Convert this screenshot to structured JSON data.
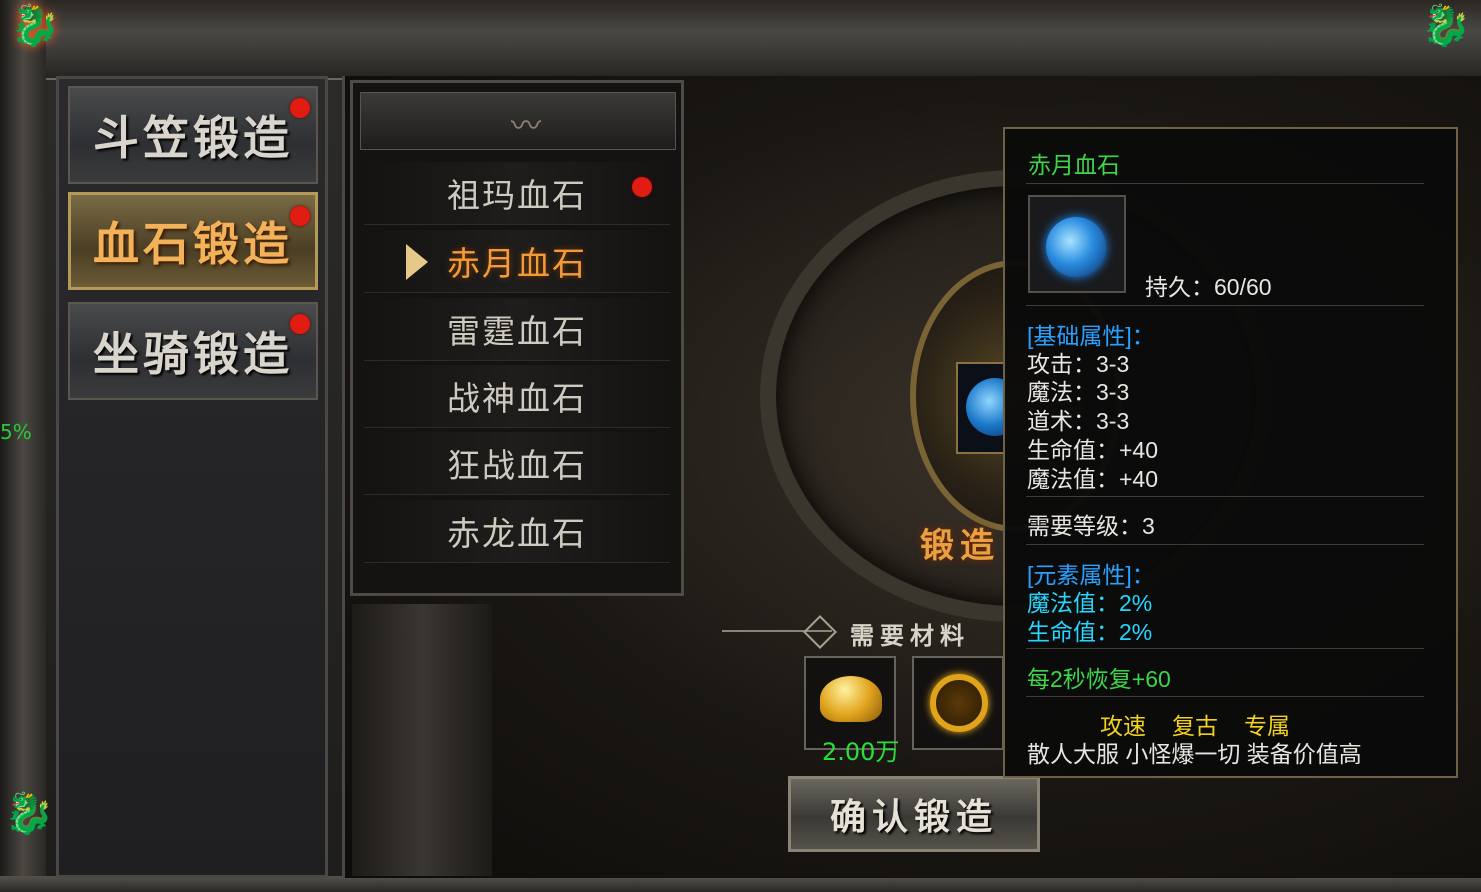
{
  "side_tabs": [
    {
      "label": "斗笠锻造"
    },
    {
      "label": "血石锻造"
    },
    {
      "label": "坐骑锻造"
    }
  ],
  "stone_list": [
    {
      "label": "祖玛血石"
    },
    {
      "label": "赤月血石"
    },
    {
      "label": "雷霆血石"
    },
    {
      "label": "战神血石"
    },
    {
      "label": "狂战血石"
    },
    {
      "label": "赤龙血石"
    }
  ],
  "forge": {
    "title": "锻造",
    "materials_title": "需要材料",
    "gold_amount": "2.00万",
    "confirm_label": "确认锻造"
  },
  "edge_percent": "5%",
  "tooltip": {
    "name": "赤月血石",
    "durability": "持久：60/60",
    "base_header": "[基础属性]：",
    "base_stats": [
      "攻击：3-3",
      "魔法：3-3",
      "道术：3-3",
      "生命值：+40",
      "魔法值：+40"
    ],
    "required_level": "需要等级：3",
    "element_header": "[元素属性]：",
    "element_stats": [
      "魔法值：2%",
      "生命值：2%"
    ],
    "regen": "每2秒恢复+60",
    "tags": [
      "攻速",
      "复古",
      "专属"
    ],
    "footer": "散人大服 小怪爆一切 装备价值高"
  },
  "colors": {
    "name_green": "#3ed54a",
    "header_blue": "#2aa0ff",
    "element_cyan": "#27d6ff",
    "tag_yellow": "#f3d21e",
    "active_orange": "#f39b3a",
    "alert_red": "#e11c12"
  }
}
